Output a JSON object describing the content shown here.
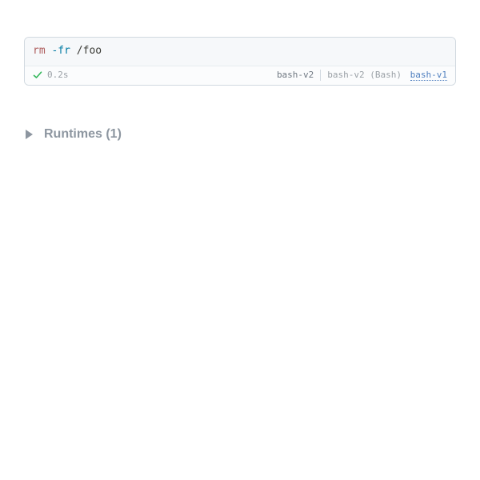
{
  "code": {
    "command": "rm",
    "flag": "-fr",
    "argument": "/foo"
  },
  "status": {
    "elapsed": "0.2s",
    "runtime": "bash-v2",
    "runtime_detail": "bash-v2 (Bash)",
    "runtime_link": "bash-v1"
  },
  "runtimes": {
    "label": "Runtimes (1)",
    "count": 1
  }
}
